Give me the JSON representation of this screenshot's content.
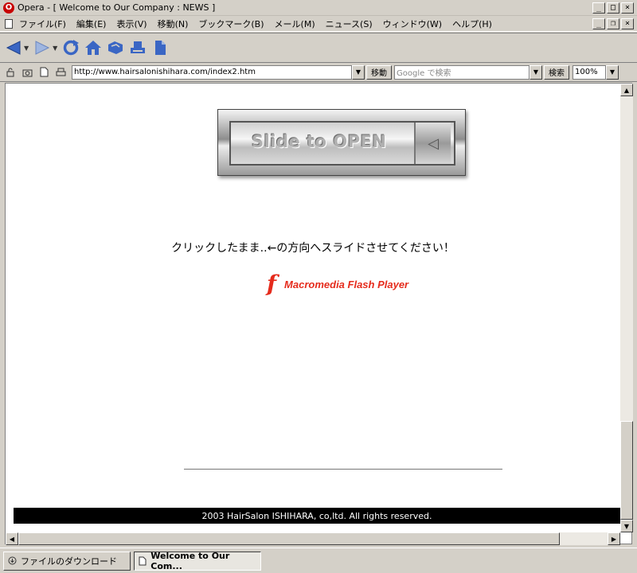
{
  "window": {
    "title": "Opera - [ Welcome to Our Company : NEWS ]",
    "app_logo": "O"
  },
  "menu": {
    "items": [
      "ファイル(F)",
      "編集(E)",
      "表示(V)",
      "移動(N)",
      "ブックマーク(B)",
      "メール(M)",
      "ニュース(S)",
      "ウィンドウ(W)",
      "ヘルプ(H)"
    ]
  },
  "nav_icons": [
    "back-arrow-icon",
    "forward-arrow-icon",
    "reload-icon",
    "home-icon",
    "bookmark-hand-icon",
    "print-icon",
    "page-icon"
  ],
  "address": {
    "url": "http://www.hairsalonishihara.com/index2.htm",
    "go_label": "移動",
    "search_placeholder": "Google で検索",
    "search_label": "検索",
    "zoom": "100%"
  },
  "page": {
    "slider_text": "Slide to OPEN",
    "slider_arrow": "◁",
    "instruction": "クリックしたまま..←の方向へスライドさせてください！",
    "flash_logo": "f",
    "flash_text": "Macromedia Flash Player",
    "footer": "2003 HairSalon ISHIHARA, co,ltd. All rights reserved."
  },
  "tabs": [
    {
      "label": "ファイルのダウンロード"
    },
    {
      "label": "Welcome to Our Com..."
    }
  ],
  "colors": {
    "flash_red": "#e52b1c",
    "nav_blue": "#3a66c4",
    "chrome": "#d4d0c8"
  }
}
